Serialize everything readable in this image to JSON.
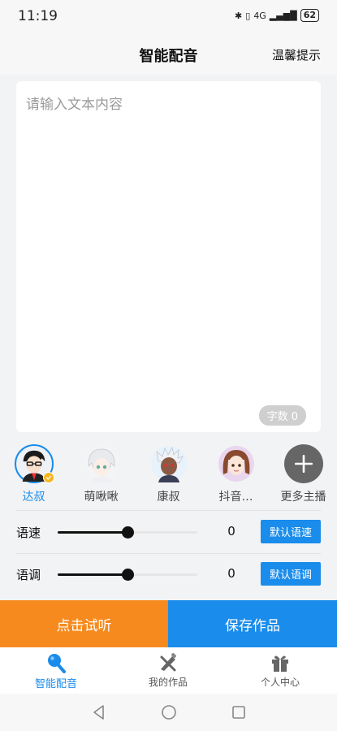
{
  "status_bar": {
    "time": "11:19",
    "network": "4G",
    "battery": "62"
  },
  "header": {
    "title": "智能配音",
    "action": "温馨提示"
  },
  "editor": {
    "placeholder": "请输入文本内容",
    "char_count": "字数 0"
  },
  "voices": [
    {
      "name": "达叔",
      "selected": true,
      "icon": "avatar-dashu"
    },
    {
      "name": "萌啾啾",
      "selected": false,
      "icon": "avatar-mengjiujiu"
    },
    {
      "name": "康叔",
      "selected": false,
      "icon": "avatar-kangshu"
    },
    {
      "name": "抖音…",
      "selected": false,
      "icon": "avatar-douyin"
    },
    {
      "name": "更多主播",
      "selected": false,
      "icon": "plus-icon"
    }
  ],
  "speed": {
    "label": "语速",
    "value": "0",
    "button": "默认语速",
    "level": 0.5
  },
  "pitch": {
    "label": "语调",
    "value": "0",
    "button": "默认语调",
    "level": 0.5
  },
  "actions": {
    "listen": "点击试听",
    "save": "保存作品"
  },
  "tabs": [
    {
      "label": "智能配音",
      "active": true,
      "icon": "microphone-icon"
    },
    {
      "label": "我的作品",
      "active": false,
      "icon": "works-icon"
    },
    {
      "label": "个人中心",
      "active": false,
      "icon": "gift-icon"
    }
  ],
  "colors": {
    "accent": "#1a8ceb",
    "listen": "#f78a1e",
    "check": "#f5b61e"
  }
}
